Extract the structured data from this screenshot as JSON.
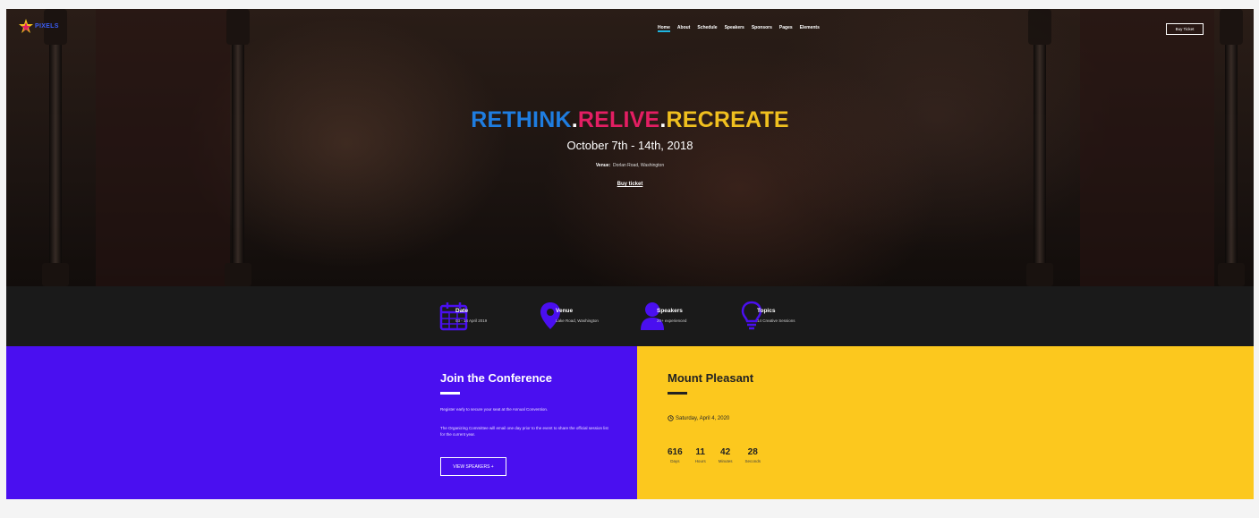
{
  "brand": {
    "logo_text": "PIXELS"
  },
  "nav": {
    "items": [
      "Home",
      "About",
      "Schedule",
      "Speakers",
      "Sponsors",
      "Pages",
      "Elements"
    ],
    "buy_label": "Buy Ticket"
  },
  "hero": {
    "title": {
      "part1": "RETHINK",
      "dot1": ".",
      "part2": "RELIVE",
      "dot2": ".",
      "part3": "RECREATE"
    },
    "date": "October 7th - 14th, 2018",
    "venue_label": "Venue:",
    "venue_value": "Dorlan Road, Washington",
    "cta": "Buy ticket"
  },
  "info": [
    {
      "icon": "calendar-icon",
      "title": "Date",
      "sub": "03 - 14 April 2019"
    },
    {
      "icon": "map-pin-icon",
      "title": "Venue",
      "sub": "Lake Road, Washington"
    },
    {
      "icon": "user-icon",
      "title": "Speakers",
      "sub": "20+ experienced"
    },
    {
      "icon": "lightbulb-icon",
      "title": "Topics",
      "sub": "14 Creative Sessions"
    }
  ],
  "join": {
    "title": "Join the Conference",
    "p1": "Register early to secure your seat at the Annual Convention.",
    "p2": "The Organizing Committee will email one day prior to the event to share the official session list for the current year.",
    "button": "VIEW SPEAKERS +"
  },
  "event": {
    "title": "Mount Pleasant",
    "date": "Saturday, April 4, 2020",
    "countdown": [
      {
        "num": "616",
        "label": "Days"
      },
      {
        "num": "11",
        "label": "Hours"
      },
      {
        "num": "42",
        "label": "Minutes"
      },
      {
        "num": "28",
        "label": "Seconds"
      }
    ]
  },
  "colors": {
    "purple": "#4a0ff0",
    "yellow": "#fcc81e",
    "blue": "#1f7de0",
    "pink": "#e31e63",
    "gold": "#f0c01f"
  }
}
